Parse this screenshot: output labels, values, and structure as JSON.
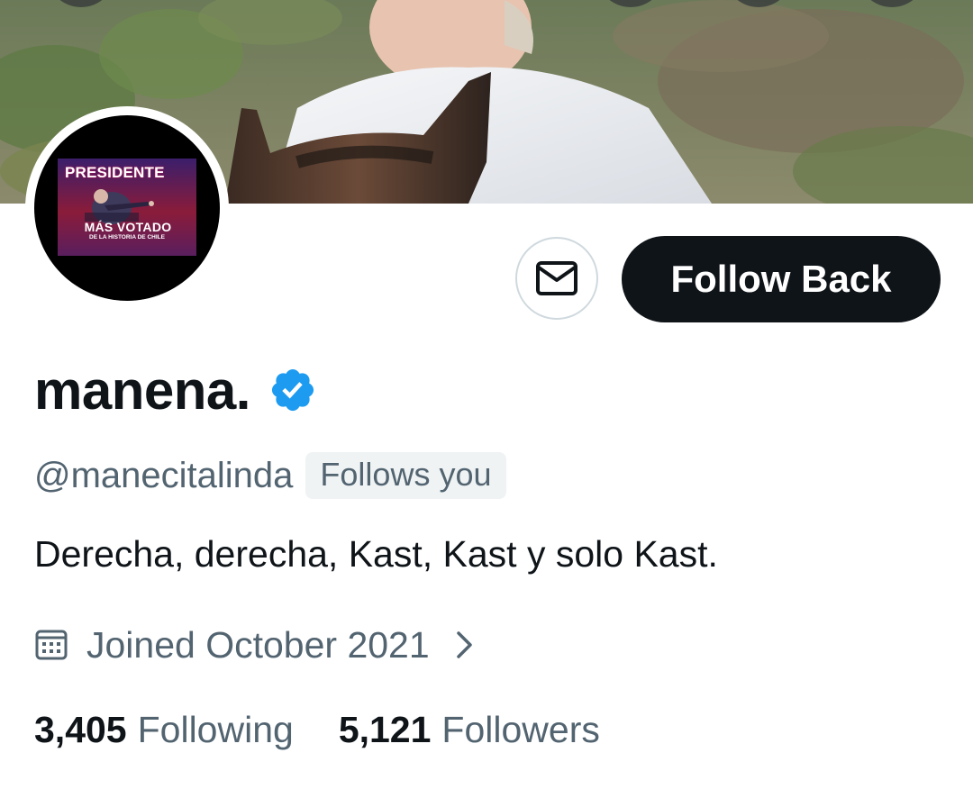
{
  "profile": {
    "display_name": "manena.",
    "handle": "@manecitalinda",
    "follows_you_badge": "Follows you",
    "bio": "Derecha, derecha, Kast, Kast y solo Kast.",
    "joined": "Joined October 2021",
    "verified": true
  },
  "avatar": {
    "poster_title": "PRESIDENTE",
    "poster_line1": "MÁS VOTADO",
    "poster_line2": "DE LA HISTORIA DE CHILE"
  },
  "actions": {
    "message_icon": "envelope-icon",
    "follow_label": "Follow Back"
  },
  "stats": {
    "following_count": "3,405",
    "following_label": "Following",
    "followers_count": "5,121",
    "followers_label": "Followers"
  },
  "colors": {
    "primary_text": "#0f1419",
    "secondary_text": "#536471",
    "verified_blue": "#1d9bf0",
    "button_dark": "#0f1419",
    "badge_bg": "#eff3f4",
    "border": "#cfd9de"
  }
}
